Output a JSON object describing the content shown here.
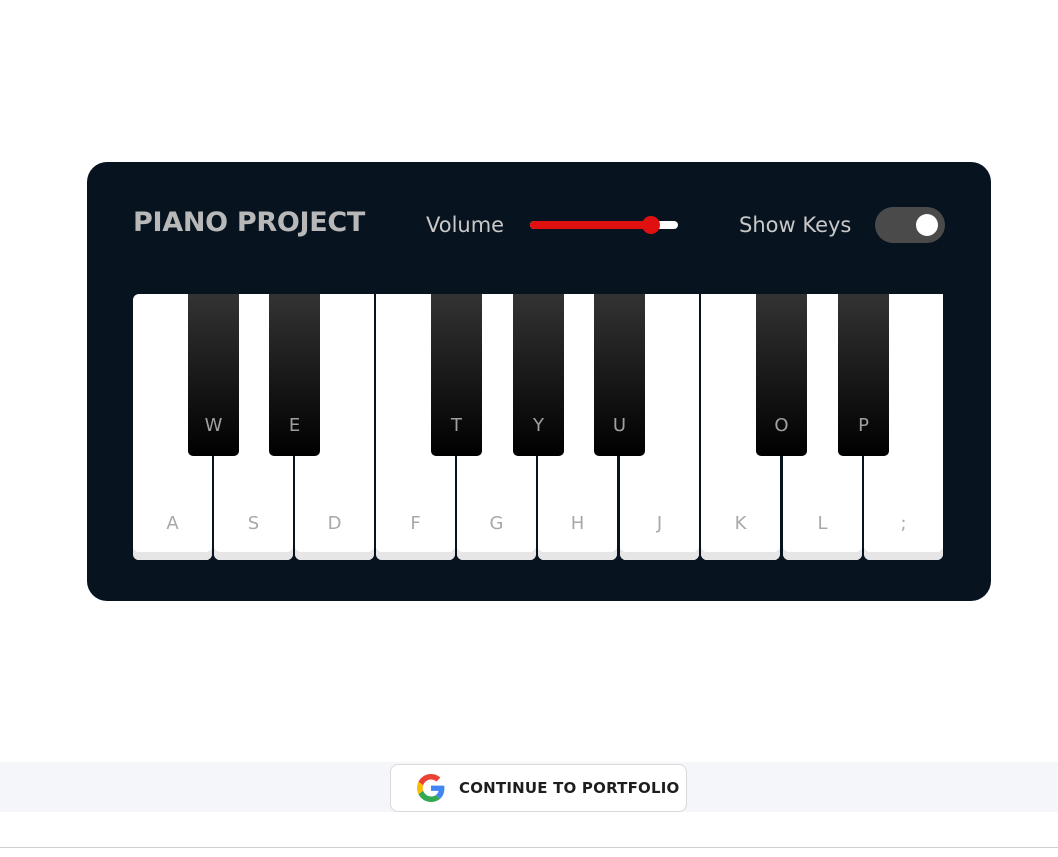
{
  "header": {
    "title": "PIANO PROJECT",
    "volume_label": "Volume",
    "volume_level": 0.86,
    "show_keys_label": "Show Keys",
    "show_keys_on": true
  },
  "white_keys": [
    "A",
    "S",
    "D",
    "F",
    "G",
    "H",
    "J",
    "K",
    "L",
    ";"
  ],
  "black_keys": [
    "W",
    "E",
    "T",
    "Y",
    "U",
    "O",
    "P"
  ],
  "footer": {
    "button_label": "CONTINUE TO PORTFOLIO",
    "button_icon": "google-icon"
  },
  "colors": {
    "panel": "#07141f",
    "accent": "#e01010",
    "toggle_track": "#4a4a4a"
  }
}
